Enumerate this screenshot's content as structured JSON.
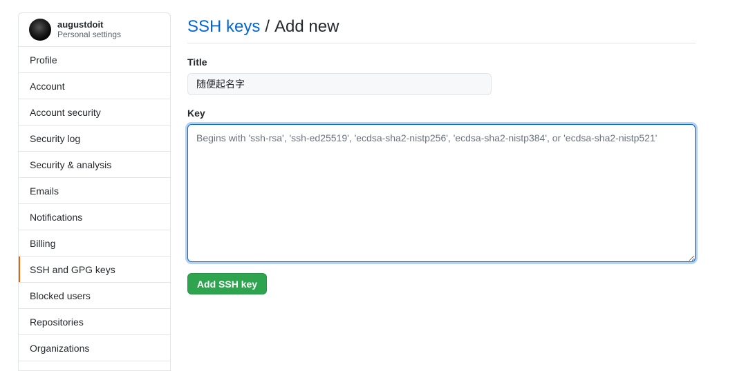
{
  "sidebar": {
    "username": "augustdoit",
    "subtitle": "Personal settings",
    "items": [
      {
        "label": "Profile",
        "selected": false
      },
      {
        "label": "Account",
        "selected": false
      },
      {
        "label": "Account security",
        "selected": false
      },
      {
        "label": "Security log",
        "selected": false
      },
      {
        "label": "Security & analysis",
        "selected": false
      },
      {
        "label": "Emails",
        "selected": false
      },
      {
        "label": "Notifications",
        "selected": false
      },
      {
        "label": "Billing",
        "selected": false
      },
      {
        "label": "SSH and GPG keys",
        "selected": true
      },
      {
        "label": "Blocked users",
        "selected": false
      },
      {
        "label": "Repositories",
        "selected": false
      },
      {
        "label": "Organizations",
        "selected": false
      }
    ]
  },
  "main": {
    "breadcrumb_link": "SSH keys",
    "breadcrumb_sep": "/",
    "breadcrumb_current": "Add new",
    "title_label": "Title",
    "title_value": "随便起名字",
    "key_label": "Key",
    "key_placeholder": "Begins with 'ssh-rsa', 'ssh-ed25519', 'ecdsa-sha2-nistp256', 'ecdsa-sha2-nistp384', or 'ecdsa-sha2-nistp521'",
    "key_value": "",
    "submit_label": "Add SSH key"
  },
  "colors": {
    "link": "#0366d6",
    "button_green": "#2ea44f",
    "selected_marker": "#e36209",
    "border": "#e1e4e8"
  }
}
